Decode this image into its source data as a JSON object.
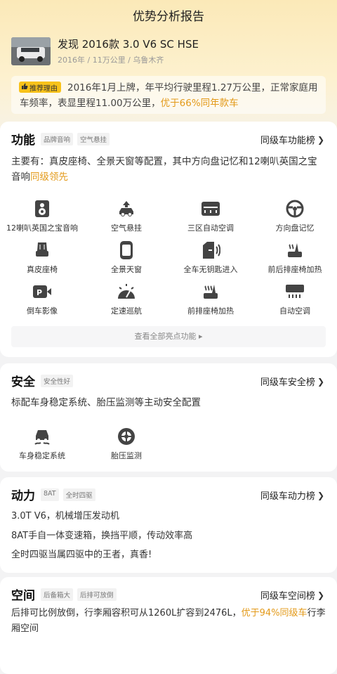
{
  "page": {
    "title": "优势分析报告"
  },
  "car": {
    "name": "发现 2016款 3.0 V6 SC HSE",
    "meta": "2016年 / 11万公里 / 乌鲁木齐"
  },
  "recommendation": {
    "tag": "推荐理由",
    "text": "2016年1月上牌，年平均行驶里程1.27万公里，正常家庭用车频率，表显里程11.00万公里，",
    "highlight": "优于66%同年款车"
  },
  "function": {
    "title": "功能",
    "tags": [
      "品牌音响",
      "空气悬挂"
    ],
    "rank": "同级车功能榜",
    "desc": "主要有：真皮座椅、全景天窗等配置，其中方向盘记忆和12喇叭英国之宝音响",
    "desc_highlight": "同级领先",
    "items": [
      {
        "label": "12喇叭英国之宝音响",
        "icon": "speaker-icon"
      },
      {
        "label": "空气悬挂",
        "icon": "air-suspension-icon"
      },
      {
        "label": "三区自动空调",
        "icon": "tri-zone-ac-icon"
      },
      {
        "label": "方向盘记忆",
        "icon": "steering-memory-icon"
      },
      {
        "label": "真皮座椅",
        "icon": "leather-seat-icon"
      },
      {
        "label": "全景天窗",
        "icon": "panoramic-sunroof-icon"
      },
      {
        "label": "全车无钥匙进入",
        "icon": "keyless-entry-icon"
      },
      {
        "label": "前后排座椅加热",
        "icon": "seat-heating-icon"
      },
      {
        "label": "倒车影像",
        "icon": "reverse-camera-icon"
      },
      {
        "label": "定速巡航",
        "icon": "cruise-control-icon"
      },
      {
        "label": "前排座椅加热",
        "icon": "front-seat-heating-icon"
      },
      {
        "label": "自动空调",
        "icon": "auto-ac-icon"
      }
    ],
    "see_all": "查看全部亮点功能"
  },
  "safety": {
    "title": "安全",
    "tags": [
      "安全性好"
    ],
    "rank": "同级车安全榜",
    "desc": "标配车身稳定系统、胎压监测等主动安全配置",
    "items": [
      {
        "label": "车身稳定系统",
        "icon": "stability-control-icon"
      },
      {
        "label": "胎压监测",
        "icon": "tire-pressure-icon"
      }
    ]
  },
  "power": {
    "title": "动力",
    "tags": [
      "8AT",
      "全时四驱"
    ],
    "rank": "同级车动力榜",
    "lines": [
      "3.0T V6，机械增压发动机",
      "8AT手自一体变速箱，换挡平顺，传动效率高",
      "全时四驱当属四驱中的王者，真香!"
    ]
  },
  "space": {
    "title": "空间",
    "tags": [
      "后备箱大",
      "后排可放倒"
    ],
    "rank": "同级车空间榜",
    "desc": "后排可比例放倒，行李厢容积可从1260L扩容到2476L，",
    "desc_highlight": "优于94%同级车",
    "desc_tail": "行李厢空间"
  },
  "colors": {
    "accent": "#e39a1a",
    "tag_yellow": "#f8c21a",
    "hero": "#fbe9b8"
  }
}
